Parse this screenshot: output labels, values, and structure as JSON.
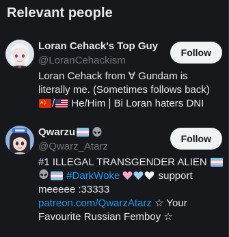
{
  "panel": {
    "title": "Relevant people"
  },
  "people": [
    {
      "name": "Loran Cehack's Top Guy",
      "handle": "@LoranCehackism",
      "follow_label": "Follow",
      "bio_line1": "Loran Cehack from ∀ Gundam is",
      "bio_line2": "literally me. (Sometimes follows back)",
      "bio_line3_sep": "/",
      "bio_line3_text": " He/Him | Bi Loran haters DNI"
    },
    {
      "name": "Qwarzu",
      "handle": "@Qwarz_Atarz",
      "follow_label": "Follow",
      "bio_line1": "#1 ILLEGAL TRANSGENDER ALIEN",
      "bio_hashtag": "#DarkWoke",
      "bio_line2_tail": " support",
      "bio_line3": "meeeee :33333",
      "bio_link": "patreon.com/QwarzAtarz",
      "bio_line4_tail": " ☆ Your",
      "bio_line5": "Favourite Russian Femboy ☆"
    }
  ],
  "icons": {
    "china_flag": "flag-cn-icon",
    "us_flag": "flag-us-icon",
    "trans_flag": "trans-flag-icon",
    "alien": "alien-icon",
    "pink_heart": "pink-heart-icon",
    "light_blue_heart": "light-blue-heart-icon",
    "white_heart": "white-heart-icon"
  },
  "colors": {
    "background": "#16181c",
    "text": "#e7e9ea",
    "secondary_text": "#71767b",
    "link": "#1d9bf0",
    "button_bg": "#eff3f4",
    "button_text": "#0f1419"
  }
}
